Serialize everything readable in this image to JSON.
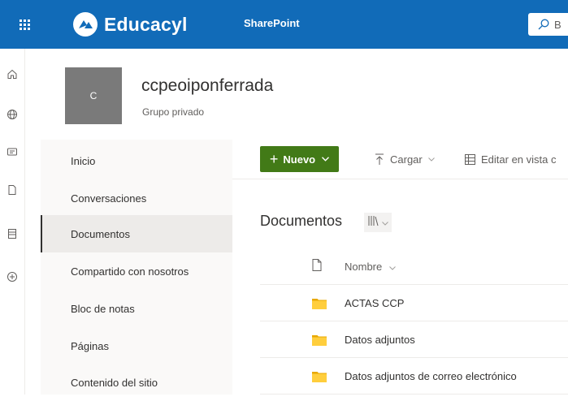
{
  "topbar": {
    "brand": "Educacyl",
    "app_link": "SharePoint",
    "search_placeholder": "B"
  },
  "site": {
    "logo_letter": "C",
    "title": "ccpeoiponferrada",
    "subtitle": "Grupo privado"
  },
  "nav": {
    "items": [
      {
        "label": "Inicio"
      },
      {
        "label": "Conversaciones"
      },
      {
        "label": "Documentos"
      },
      {
        "label": "Compartido con nosotros"
      },
      {
        "label": "Bloc de notas"
      },
      {
        "label": "Páginas"
      },
      {
        "label": "Contenido del sitio"
      }
    ],
    "selected": "Documentos"
  },
  "commands": {
    "new_label": "Nuevo",
    "upload_label": "Cargar",
    "edit_grid_label": "Editar en vista c"
  },
  "library": {
    "title": "Documentos",
    "column_name": "Nombre",
    "items": [
      {
        "name": "ACTAS CCP"
      },
      {
        "name": "Datos adjuntos"
      },
      {
        "name": "Datos adjuntos de correo electrónico"
      }
    ]
  },
  "colors": {
    "suite_bar": "#116bb8",
    "new_button": "#427a17",
    "folder": "#ffce3d"
  }
}
